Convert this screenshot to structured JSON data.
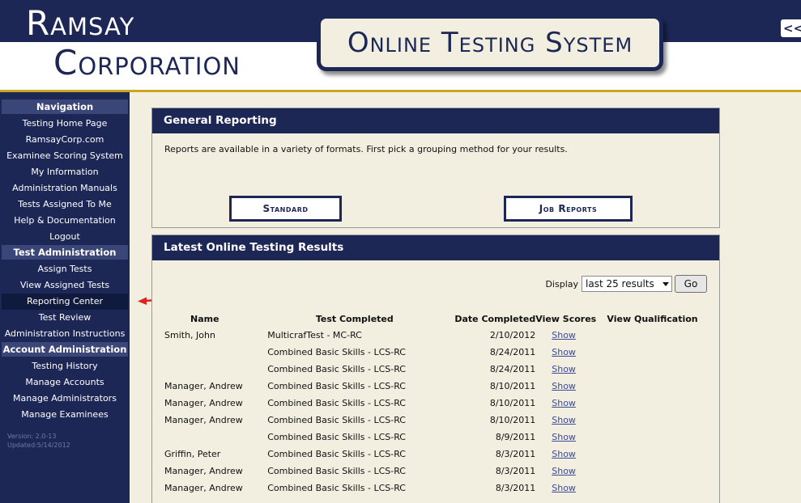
{
  "header": {
    "logo_line1": "Ramsay",
    "logo_line2": "Corporation",
    "system_title": "Online Testing System",
    "collapse_label": "<<"
  },
  "sidebar": {
    "sections": [
      {
        "title": "Navigation",
        "items": [
          "Testing Home Page",
          "RamsayCorp.com",
          "Examinee Scoring System",
          "My Information",
          "Administration Manuals",
          "Tests Assigned To Me",
          "Help & Documentation",
          "Logout"
        ]
      },
      {
        "title": "Test Administration",
        "items": [
          "Assign Tests",
          "View Assigned Tests",
          "Reporting Center",
          "Test Review",
          "Administration Instructions"
        ]
      },
      {
        "title": "Account Administration",
        "items": [
          "Testing History",
          "Manage Accounts",
          "Manage Administrators",
          "Manage Examinees"
        ]
      }
    ],
    "active_item": "Reporting Center",
    "version": "Version: 2.0-13",
    "updated": "Updated:5/14/2012"
  },
  "general_reporting": {
    "title": "General Reporting",
    "description": "Reports are available in a variety of formats. First pick a grouping method for your results.",
    "standard_button": "Standard",
    "job_reports_button": "Job Reports"
  },
  "latest_results": {
    "title": "Latest Online Testing Results",
    "display_label": "Display",
    "display_value": "last 25 results",
    "go_label": "Go",
    "columns": [
      "Name",
      "Test Completed",
      "Date Completed",
      "View Scores",
      "View Qualification"
    ],
    "rows": [
      {
        "name": "Smith, John",
        "test": "MulticrafTest - MC-RC",
        "date": "2/10/2012",
        "view": "Show"
      },
      {
        "name": "",
        "test": "Combined Basic Skills - LCS-RC",
        "date": "8/24/2011",
        "view": "Show"
      },
      {
        "name": "",
        "test": "Combined Basic Skills - LCS-RC",
        "date": "8/24/2011",
        "view": "Show"
      },
      {
        "name": "Manager, Andrew",
        "test": "Combined Basic Skills - LCS-RC",
        "date": "8/10/2011",
        "view": "Show"
      },
      {
        "name": "Manager, Andrew",
        "test": "Combined Basic Skills - LCS-RC",
        "date": "8/10/2011",
        "view": "Show"
      },
      {
        "name": "Manager, Andrew",
        "test": "Combined Basic Skills - LCS-RC",
        "date": "8/10/2011",
        "view": "Show"
      },
      {
        "name": "",
        "test": "Combined Basic Skills - LCS-RC",
        "date": "8/9/2011",
        "view": "Show"
      },
      {
        "name": "Griffin, Peter",
        "test": "Combined Basic Skills - LCS-RC",
        "date": "8/3/2011",
        "view": "Show"
      },
      {
        "name": "Manager, Andrew",
        "test": "Combined Basic Skills - LCS-RC",
        "date": "8/3/2011",
        "view": "Show"
      },
      {
        "name": "Manager, Andrew",
        "test": "Combined Basic Skills - LCS-RC",
        "date": "8/3/2011",
        "view": "Show"
      }
    ]
  },
  "colors": {
    "navy": "#1c2756",
    "gold": "#c9a820",
    "parchment": "#f2efe0",
    "annotation_red": "#e02020"
  }
}
